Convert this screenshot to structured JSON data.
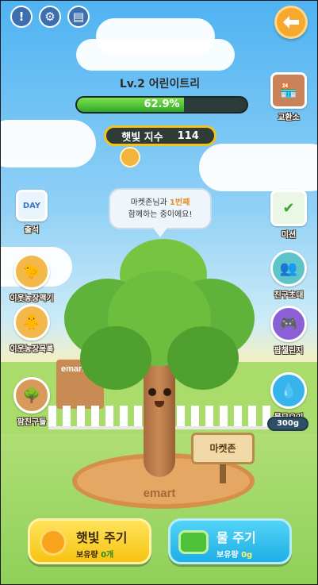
{
  "header": {
    "level_title": "Lv.2 어린이트리",
    "progress_text": "62.9%",
    "progress_fraction": 0.629,
    "sun_label": "햇빛 지수",
    "sun_value": "114"
  },
  "top_icons": [
    "info-icon",
    "gear-icon",
    "book-icon",
    "back-arrow-icon"
  ],
  "left_menu": [
    {
      "label": "출석",
      "icon_text": "DAY"
    },
    {
      "label": "이웃농장맥기"
    },
    {
      "label": "이웃농장목록"
    },
    {
      "label": "팜친구들"
    }
  ],
  "right_menu": [
    {
      "label": "교환소"
    },
    {
      "label": "미션"
    },
    {
      "label": "친구초대"
    },
    {
      "label": "팜챌린지"
    },
    {
      "label": "물모으기"
    }
  ],
  "water_collected": "300g",
  "bubble": {
    "line1_a": "마켓존님과 ",
    "line1_b": "1번째",
    "line2": "함께하는 중이에요!"
  },
  "tree_name": "마켓존",
  "ground_logo": "emart",
  "building_sign": "emart",
  "buttons": {
    "sunlight": {
      "title": "햇빛 주기",
      "sub_label": "보유량",
      "sub_value": "0개"
    },
    "water": {
      "title": "물 주기",
      "sub_label": "보유량",
      "sub_value": "0g"
    }
  },
  "colors": {
    "progress_fill": "#3fbf33",
    "sun_button": "#fbd22a",
    "water_button": "#36c0ef",
    "back_button": "#f6a92e"
  }
}
